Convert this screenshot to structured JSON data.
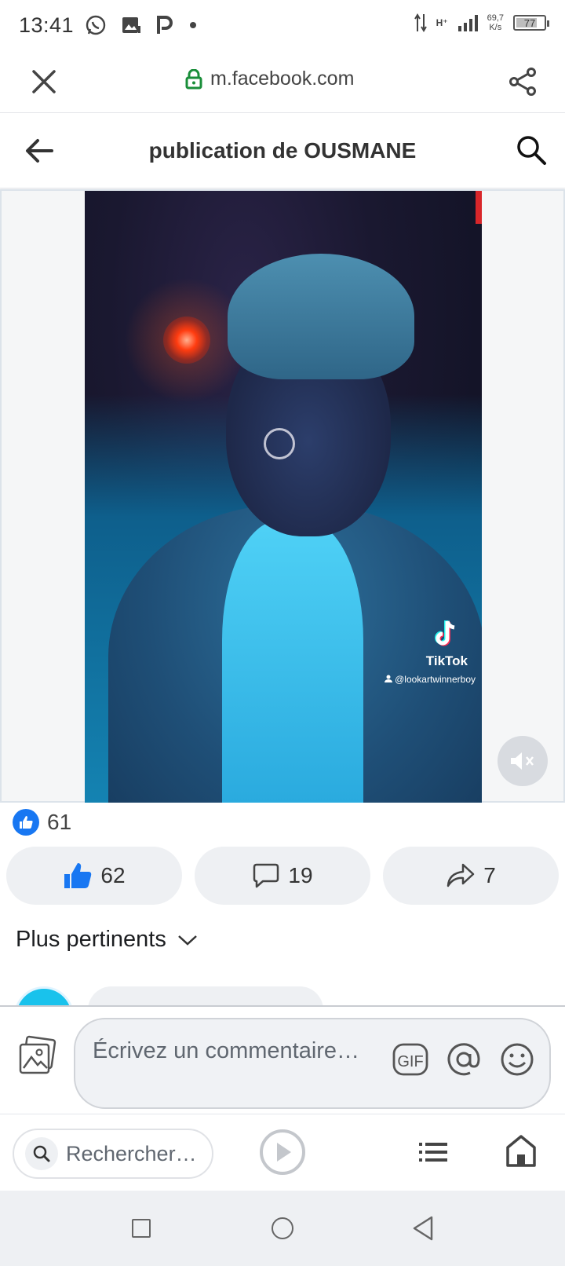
{
  "status_bar": {
    "time": "13:41",
    "network": "H⁺",
    "speed_value": "69,7",
    "speed_unit": "K/s",
    "battery": "77",
    "battery_level": 0.77
  },
  "browser": {
    "url": "m.facebook.com"
  },
  "header": {
    "title": "publication de OUSMANE"
  },
  "video": {
    "watermark_name": "TikTok",
    "watermark_user": "@lookartwinnerboy"
  },
  "reactions": {
    "count": "61"
  },
  "actions": {
    "like_count": "62",
    "comment_count": "19",
    "share_count": "7"
  },
  "comments": {
    "sort_label": "Plus pertinents",
    "placeholder": "Écrivez un commentaire…",
    "gif_label": "GIF"
  },
  "bottom_nav": {
    "search_placeholder": "Rechercher…"
  },
  "colors": {
    "brand_blue": "#1877f2",
    "secure_green": "#1a8e3a"
  }
}
